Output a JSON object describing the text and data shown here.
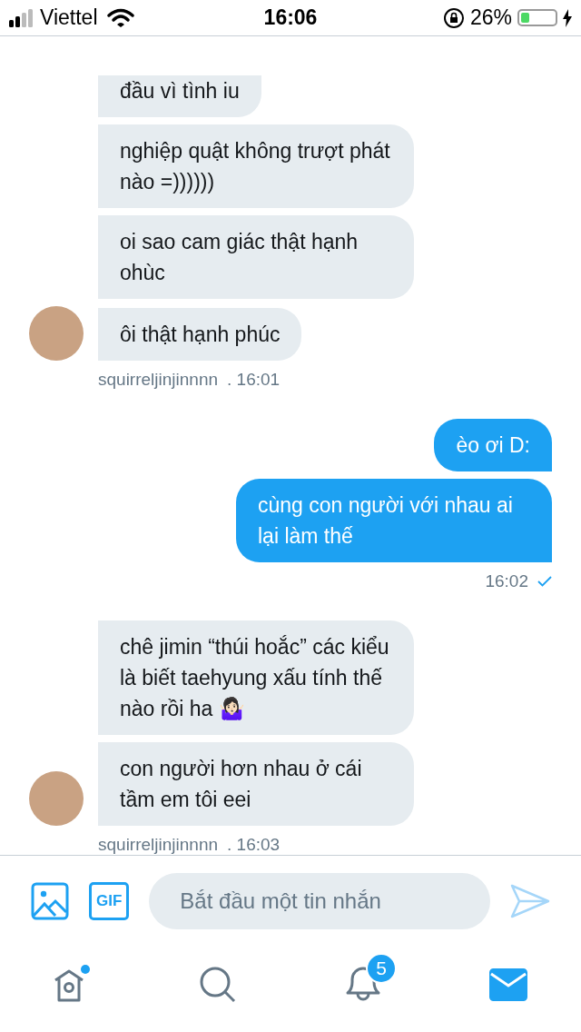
{
  "status_bar": {
    "carrier": "Viettel",
    "time": "16:06",
    "battery_text": "26%",
    "battery": {
      "level": 0.26
    },
    "charging": true
  },
  "messages": [
    {
      "kind": "in",
      "bubbles": [
        "đầu vì tình iu",
        "nghiệp quật không trượt phát nào =))))))",
        "oi sao cam giác thật hạnh ohùc",
        "ôi thật hạnh phúc"
      ],
      "sender": "squirreljinjinnnn",
      "time": ". 16:01",
      "cut_top": true
    },
    {
      "kind": "out",
      "bubbles": [
        "èo ơi D:",
        "cùng con người với nhau ai lại làm thế"
      ],
      "time": "16:02",
      "read": true
    },
    {
      "kind": "in",
      "bubbles": [
        "chê jimin “thúi hoắc” các kiểu là biết taehyung xấu tính thế nào rồi ha 🤷🏻‍♀️",
        "con người hơn nhau ở cái tầm em tôi eei"
      ],
      "sender": "squirreljinjinnnn",
      "time": ". 16:03"
    }
  ],
  "composer": {
    "placeholder": "Bắt đầu một tin nhắn",
    "gif_label": "GIF"
  },
  "tabs": [
    {
      "kind": "home",
      "selected": false,
      "dot": true
    },
    {
      "kind": "search",
      "selected": false
    },
    {
      "kind": "notifications",
      "selected": false,
      "badge": "5"
    },
    {
      "kind": "messages",
      "selected": true
    }
  ]
}
